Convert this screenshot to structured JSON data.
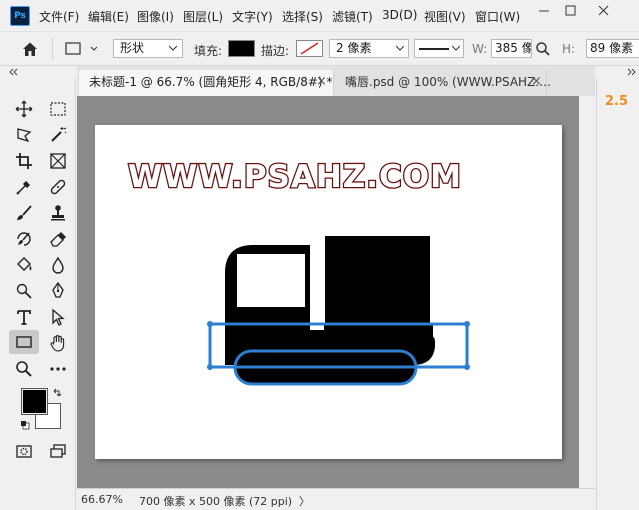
{
  "app": {
    "logo_text": "Ps"
  },
  "menu": {
    "items": [
      "文件(F)",
      "编辑(E)",
      "图像(I)",
      "图层(L)",
      "文字(Y)",
      "选择(S)",
      "滤镜(T)",
      "3D(D)",
      "视图(V)",
      "窗口(W)"
    ]
  },
  "options": {
    "mode_value": "形状",
    "fill_label": "填充:",
    "fill_color": "#000000",
    "stroke_label": "描边:",
    "stroke_width_value": "2 像素",
    "w_label": "W:",
    "w_value": "385 像",
    "h_label": "H:",
    "h_value": "89 像素"
  },
  "tabs": [
    {
      "label": "未标题-1 @ 66.7% (圆角矩形 4, RGB/8#) *",
      "close": "×"
    },
    {
      "label": "嘴唇.psd @ 100% (WWW.PSAHZ.…",
      "close": "×"
    }
  ],
  "canvas": {
    "watermark_text": "WWW.PSAHZ.COM",
    "selection_color": "#2d7fd3"
  },
  "status": {
    "zoom": "66.67%",
    "doc_info": "700 像素 x 500 像素 (72 ppi)",
    "arrow": "〉"
  },
  "right_panel": {
    "value": "2.5",
    "accent": "#f08c1a"
  },
  "colors": {
    "foreground": "#000000",
    "background": "#ffffff"
  }
}
